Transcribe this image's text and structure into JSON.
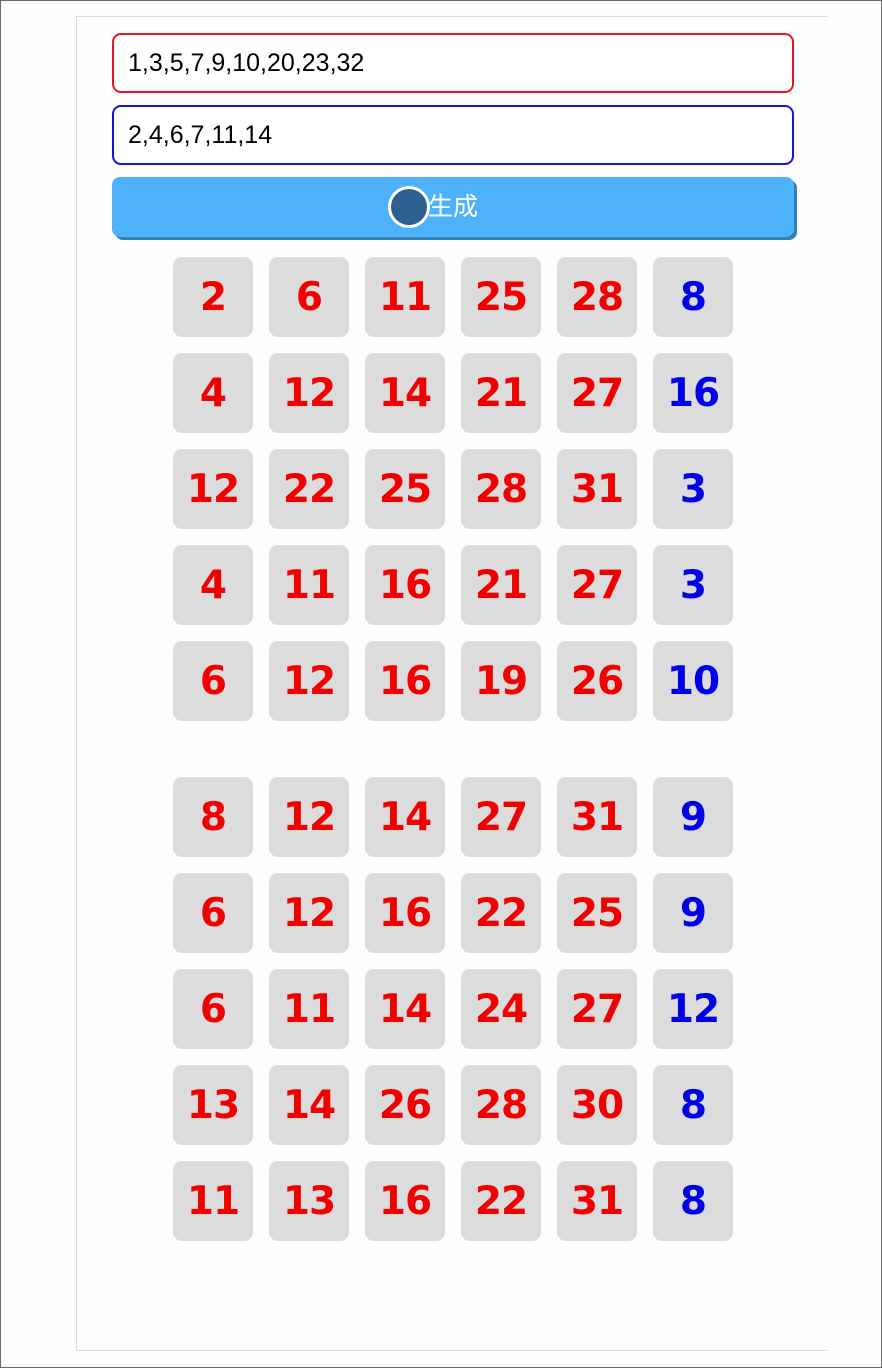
{
  "inputs": {
    "red_numbers": "1,3,5,7,9,10,20,23,32",
    "blue_numbers": "2,4,6,7,11,14"
  },
  "generate_button": {
    "label": "生成"
  },
  "colors": {
    "red": "#f00000",
    "blue": "#0000e6",
    "button": "#4db2fa",
    "cell_bg": "#dcdcdc"
  },
  "groups": [
    {
      "rows": [
        {
          "reds": [
            "2",
            "6",
            "11",
            "25",
            "28"
          ],
          "blue": "8"
        },
        {
          "reds": [
            "4",
            "12",
            "14",
            "21",
            "27"
          ],
          "blue": "16"
        },
        {
          "reds": [
            "12",
            "22",
            "25",
            "28",
            "31"
          ],
          "blue": "3"
        },
        {
          "reds": [
            "4",
            "11",
            "16",
            "21",
            "27"
          ],
          "blue": "3"
        },
        {
          "reds": [
            "6",
            "12",
            "16",
            "19",
            "26"
          ],
          "blue": "10"
        }
      ]
    },
    {
      "rows": [
        {
          "reds": [
            "8",
            "12",
            "14",
            "27",
            "31"
          ],
          "blue": "9"
        },
        {
          "reds": [
            "6",
            "12",
            "16",
            "22",
            "25"
          ],
          "blue": "9"
        },
        {
          "reds": [
            "6",
            "11",
            "14",
            "24",
            "27"
          ],
          "blue": "12"
        },
        {
          "reds": [
            "13",
            "14",
            "26",
            "28",
            "30"
          ],
          "blue": "8"
        },
        {
          "reds": [
            "11",
            "13",
            "16",
            "22",
            "31"
          ],
          "blue": "8"
        }
      ]
    }
  ]
}
